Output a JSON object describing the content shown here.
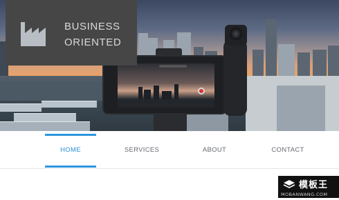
{
  "brand": {
    "line1": "BUSINESS",
    "line2": "ORIENTED",
    "icon": "factory-icon"
  },
  "hero": {
    "image": "city-skyline-sunset-with-phone-gimbal"
  },
  "nav": {
    "items": [
      {
        "label": "HOME",
        "active": true
      },
      {
        "label": "SERVICES",
        "active": false
      },
      {
        "label": "ABOUT",
        "active": false
      },
      {
        "label": "CONTACT",
        "active": false
      }
    ]
  },
  "watermark": {
    "text": "模板王",
    "sub": "MOBANWANG.COM"
  },
  "colors": {
    "accent": "#2d96de",
    "brand_box": "#464646",
    "nav_text": "#666a70"
  }
}
